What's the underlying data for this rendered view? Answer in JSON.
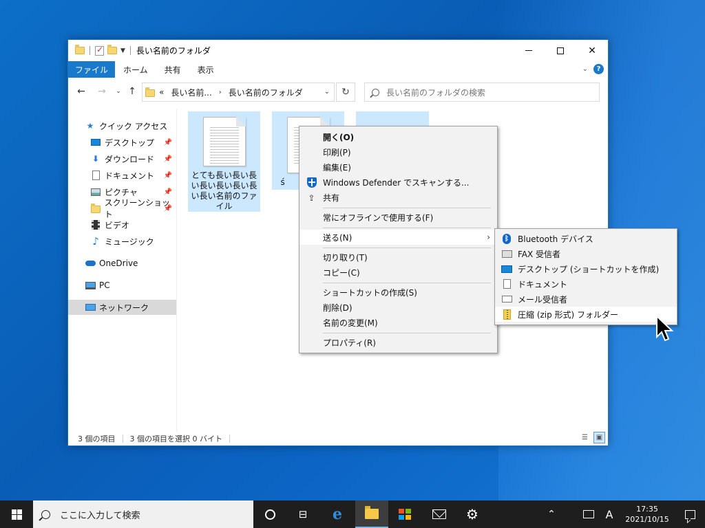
{
  "window": {
    "title": "長い名前のフォルダ",
    "controls": {
      "minimize": "",
      "maximize": "",
      "close": "✕"
    }
  },
  "ribbon": {
    "tabs": [
      "ファイル",
      "ホーム",
      "共有",
      "表示"
    ],
    "help": "?"
  },
  "address": {
    "crumbs": [
      "«",
      "長い名前...",
      "長い名前のフォルダ"
    ],
    "search_placeholder": "長い名前のフォルダの検索"
  },
  "nav": {
    "items": [
      {
        "label": "クイック アクセス",
        "icon": "star-icon"
      },
      {
        "label": "デスクトップ",
        "icon": "desktop-icon",
        "pinned": true
      },
      {
        "label": "ダウンロード",
        "icon": "download-icon",
        "pinned": true
      },
      {
        "label": "ドキュメント",
        "icon": "document-icon",
        "pinned": true
      },
      {
        "label": "ピクチャ",
        "icon": "pictures-icon",
        "pinned": true
      },
      {
        "label": "スクリーンショット",
        "icon": "folder-icon",
        "pinned": true
      },
      {
        "label": "ビデオ",
        "icon": "video-icon"
      },
      {
        "label": "ミュージック",
        "icon": "music-icon"
      },
      {
        "label": "OneDrive",
        "icon": "cloud-icon"
      },
      {
        "label": "PC",
        "icon": "pc-icon"
      },
      {
        "label": "ネットワーク",
        "icon": "network-icon",
        "selected": true
      }
    ]
  },
  "files": [
    {
      "name": "とても長い長い長い長い長い長い長い長い名前のファイル"
    },
    {
      "name": "ś"
    },
    {
      "name": ""
    }
  ],
  "status": {
    "count": "3 個の項目",
    "selection": "3 個の項目を選択  0 バイト"
  },
  "context_menu": {
    "items": [
      {
        "label": "開く(O)",
        "bold": true
      },
      {
        "label": "印刷(P)"
      },
      {
        "label": "編集(E)"
      },
      {
        "label": "Windows Defender でスキャンする...",
        "icon": "defender-shield-icon"
      },
      {
        "label": "共有",
        "icon": "share-icon"
      },
      {
        "label": "常にオフラインで使用する(F)"
      },
      {
        "label": "送る(N)",
        "submenu": true
      },
      {
        "label": "切り取り(T)"
      },
      {
        "label": "コピー(C)"
      },
      {
        "label": "ショートカットの作成(S)"
      },
      {
        "label": "削除(D)"
      },
      {
        "label": "名前の変更(M)"
      },
      {
        "label": "プロパティ(R)"
      }
    ]
  },
  "send_to_menu": {
    "items": [
      {
        "label": "Bluetooth デバイス",
        "icon": "bluetooth-icon"
      },
      {
        "label": "FAX 受信者",
        "icon": "fax-icon"
      },
      {
        "label": "デスクトップ (ショートカットを作成)",
        "icon": "desktop-icon"
      },
      {
        "label": "ドキュメント",
        "icon": "document-icon"
      },
      {
        "label": "メール受信者",
        "icon": "mail-icon"
      },
      {
        "label": "圧縮 (zip 形式) フォルダー",
        "icon": "zip-folder-icon"
      }
    ]
  },
  "taskbar": {
    "search_placeholder": "ここに入力して検索",
    "ime": "A",
    "time": "17:35",
    "date": "2021/10/15"
  }
}
